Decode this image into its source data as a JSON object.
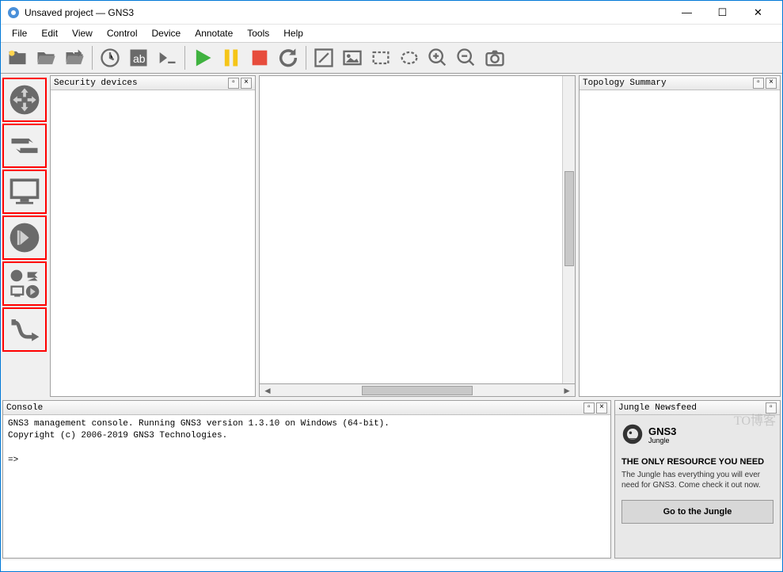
{
  "window": {
    "title": "Unsaved project — GNS3"
  },
  "menu": [
    "File",
    "Edit",
    "View",
    "Control",
    "Device",
    "Annotate",
    "Tools",
    "Help"
  ],
  "panels": {
    "security_devices": "Security devices",
    "topology_summary": "Topology Summary",
    "console": "Console",
    "jungle_newsfeed": "Jungle Newsfeed"
  },
  "console": {
    "line1": "GNS3 management console. Running GNS3 version 1.3.10 on Windows (64-bit).",
    "line2": "Copyright (c) 2006-2019 GNS3 Technologies.",
    "prompt": "=>"
  },
  "jungle": {
    "brand": "GNS3",
    "brand_sub": "Jungle",
    "headline": "THE ONLY RESOURCE YOU NEED",
    "desc": "The Jungle has everything you will ever need for GNS3. Come check it out now.",
    "button": "Go to the Jungle"
  },
  "annotations": {
    "router": "路由器",
    "switch": "交换机",
    "pc": "PC端用户",
    "save": "保存装置",
    "all": "所有设备显示",
    "cable": "网线"
  },
  "watermark": "TO博客"
}
